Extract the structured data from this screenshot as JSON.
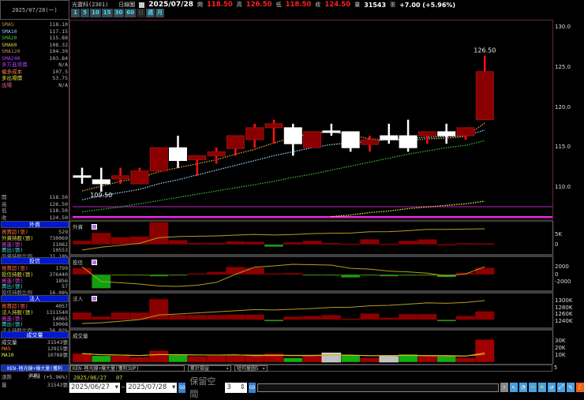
{
  "left": {
    "date": "2025/07/28(一)",
    "sma": [
      {
        "label": "SMA5",
        "value": "118.10",
        "color": "#d08a40"
      },
      {
        "label": "SMA10",
        "value": "117.15",
        "color": "#80c8ff"
      },
      {
        "label": "SMA20",
        "value": "115.88",
        "color": "#40c040"
      },
      {
        "label": "SMA60",
        "value": "108.32",
        "color": "#d0d040"
      },
      {
        "label": "SMA120",
        "value": "104.39",
        "color": "#c08a60"
      },
      {
        "label": "SMA240",
        "value": "103.84",
        "color": "#c040ff"
      }
    ],
    "signals": [
      {
        "label": "多方進場價",
        "value": "N/A",
        "color": "#a040ff"
      },
      {
        "label": "偏多成本",
        "value": "107.5",
        "color": "#ff8040"
      },
      {
        "label": "多出場價",
        "value": "53.75",
        "color": "#e0e040"
      },
      {
        "label": "出場",
        "value": "N/A",
        "color": "#ff60a0"
      }
    ],
    "ohlc": [
      {
        "label": "開",
        "value": "118.50"
      },
      {
        "label": "高",
        "value": "126.50"
      },
      {
        "label": "低",
        "value": "118.50"
      },
      {
        "label": "收",
        "value": "124.50"
      }
    ],
    "sections": [
      {
        "title": "外資",
        "rows": [
          {
            "label": "買賣超(張)",
            "value": "529",
            "color": "#ff6040"
          },
          {
            "label": "外資持股(張)",
            "value": "730069",
            "color": "#e0e040"
          },
          {
            "label": "買進(張)",
            "value": "11082",
            "color": "#e040e0"
          },
          {
            "label": "賣出(張)",
            "value": "10553",
            "color": "#40e0e0"
          },
          {
            "label": "外資持股比例",
            "value": "31.18%",
            "color": "#999"
          }
        ]
      },
      {
        "title": "投信",
        "rows": [
          {
            "label": "買賣超(張)",
            "value": "1799",
            "color": "#ff6040"
          },
          {
            "label": "投信持股(張)",
            "value": "376440",
            "color": "#e0e040"
          },
          {
            "label": "買進(張)",
            "value": "1856",
            "color": "#e040e0"
          },
          {
            "label": "賣出(張)",
            "value": "57",
            "color": "#40e0e0"
          },
          {
            "label": "投信持股比例",
            "value": "16.08%",
            "color": "#999"
          }
        ]
      },
      {
        "title": "法人",
        "rows": [
          {
            "label": "買賣超(張)",
            "value": "4057",
            "color": "#ff6040"
          },
          {
            "label": "法人持股(張)",
            "value": "1311540",
            "color": "#e0e040"
          },
          {
            "label": "買進(張)",
            "value": "14065",
            "color": "#e040e0"
          },
          {
            "label": "賣出(張)",
            "value": "10008",
            "color": "#40e0e0"
          },
          {
            "label": "法人持股比例",
            "value": "56.02%",
            "color": "#999"
          }
        ]
      },
      {
        "title": "成交量",
        "rows": [
          {
            "label": "成交量",
            "value": "31543張",
            "color": "#ccc"
          },
          {
            "label": "MA5",
            "value": "12915張",
            "color": "#ff8040"
          },
          {
            "label": "MA10",
            "value": "10788張",
            "color": "#e0e040"
          }
        ]
      }
    ],
    "strategy_bar": "KEN-極光線+爆大量(獲利3UP)",
    "change_label": "漲跌",
    "change_value": "7.00 (+5.96%)",
    "volume_label": "量",
    "volume_value": "31543張"
  },
  "header": {
    "stock": "光寶科(2301)",
    "chart_type": "日線圖",
    "date": "2025/07/28",
    "open_label": "開",
    "open": "118.50",
    "high_label": "高",
    "high": "126.50",
    "low_label": "低",
    "low": "118.50",
    "close_label": "收",
    "close": "124.50",
    "volume_label": "量",
    "volume": "31543",
    "volume_unit": "張",
    "change": "+7.00 (+5.96%)",
    "periods": [
      "1",
      "5",
      "10",
      "15",
      "30",
      "60",
      "日",
      "週",
      "月"
    ]
  },
  "chart_data": {
    "type": "candlestick",
    "dates": [
      "2025/06/27",
      "07"
    ],
    "price_axis": {
      "ticks": [
        "130.0",
        "125.0",
        "120.0",
        "115.0",
        "110.0"
      ],
      "range": [
        106.2,
        130.8
      ]
    },
    "annotations": {
      "high": "126.50",
      "low": "109.50"
    },
    "candles": [
      [
        111.5,
        112.5,
        110.5,
        111.5
      ],
      [
        111.0,
        112.5,
        109.5,
        110.5
      ],
      [
        111.1,
        112.5,
        110.5,
        111.5
      ],
      [
        110.5,
        112.5,
        110.5,
        112.1
      ],
      [
        112.1,
        115.0,
        112.1,
        115.0
      ],
      [
        115.0,
        116.5,
        112.5,
        113.4
      ],
      [
        113.5,
        114.0,
        111.5,
        114.0
      ],
      [
        114.0,
        115.0,
        113.0,
        114.5
      ],
      [
        114.9,
        116.5,
        114.0,
        116.5
      ],
      [
        116.0,
        118.0,
        115.0,
        117.5
      ],
      [
        117.5,
        118.5,
        115.5,
        118.0
      ],
      [
        117.5,
        118.0,
        114.0,
        115.5
      ],
      [
        115.0,
        117.0,
        115.0,
        117.0
      ],
      [
        117.1,
        118.0,
        116.5,
        117.0
      ],
      [
        117.0,
        117.0,
        114.5,
        115.0
      ],
      [
        115.4,
        116.5,
        114.5,
        116.0
      ],
      [
        116.5,
        118.0,
        115.5,
        116.0
      ],
      [
        116.5,
        118.5,
        114.5,
        115.0
      ],
      [
        116.5,
        117.0,
        115.5,
        117.0
      ],
      [
        117.0,
        118.0,
        115.5,
        116.5
      ],
      [
        116.5,
        117.5,
        116.0,
        117.5
      ],
      [
        118.5,
        126.5,
        118.5,
        124.5
      ]
    ],
    "ma_series": [
      {
        "name": "SMA5",
        "color": "#f0a030",
        "values": [
          109.6,
          110.2,
          110.8,
          111.2,
          112,
          112.5,
          113,
          113.5,
          114.2,
          114.8,
          115.6,
          116.3,
          116.8,
          117,
          116.6,
          116.1,
          116,
          115.9,
          116.1,
          116.2,
          116.4,
          118.1
        ]
      },
      {
        "name": "SMA10",
        "color": "#90d0ff",
        "values": [
          108.5,
          109,
          109.4,
          109.8,
          110.5,
          111,
          111.6,
          112.2,
          112.8,
          113.4,
          114,
          114.5,
          115,
          115.4,
          115.6,
          115.8,
          116,
          116.2,
          116.3,
          116.4,
          116.5,
          117.2
        ]
      },
      {
        "name": "SMA20",
        "color": "#30c030",
        "values": [
          107,
          107.3,
          107.6,
          108,
          108.4,
          108.8,
          109.2,
          109.6,
          110,
          110.4,
          110.8,
          111.3,
          111.7,
          112.2,
          112.7,
          113.2,
          113.7,
          114.2,
          114.6,
          115,
          115.3,
          115.9
        ]
      },
      {
        "name": "SMA60",
        "color": "#f0f040",
        "values": [
          null,
          null,
          null,
          null,
          null,
          null,
          null,
          null,
          null,
          null,
          null,
          null,
          null,
          106.4,
          106.6,
          106.9,
          107.1,
          107.4,
          107.6,
          107.8,
          108.0,
          108.32
        ]
      }
    ],
    "panels": [
      {
        "name": "外資",
        "ticks": [
          {
            "v": 5000,
            "t": "5K"
          },
          {
            "v": 0,
            "t": "0"
          }
        ],
        "range": [
          -4000,
          10500
        ],
        "values": [
          1800,
          5700,
          3600,
          3900,
          11000,
          2100,
          700,
          700,
          1500,
          1300,
          -1200,
          1000,
          1800,
          700,
          300,
          2500,
          300,
          1800,
          2500,
          100,
          600,
          529
        ],
        "holding_end": 730069
      },
      {
        "name": "投信",
        "ticks": [
          {
            "v": 2000,
            "t": "2000"
          },
          {
            "v": 0,
            "t": "0"
          },
          {
            "v": -2000,
            "t": "-2000"
          }
        ],
        "range": [
          -3800,
          4200
        ],
        "values": [
          1700,
          -3700,
          -300,
          -300,
          -500,
          -100,
          300,
          700,
          2000,
          1800,
          300,
          400,
          -100,
          -100,
          -800,
          -200,
          -500,
          -200,
          -300,
          -700,
          500,
          1799
        ],
        "holding_end": 376440
      },
      {
        "name": "法人",
        "ticks": [
          {
            "v": 1300,
            "t": "1300K"
          },
          {
            "v": 1280,
            "t": "1280K"
          },
          {
            "v": 1260,
            "t": "1260K"
          },
          {
            "v": 1240,
            "t": "1240K"
          }
        ],
        "range": [
          -3000,
          12000
        ],
        "values": [
          3500,
          1500,
          3500,
          3500,
          10000,
          2300,
          2300,
          2300,
          2500,
          2500,
          -800,
          1500,
          1800,
          2200,
          500,
          3000,
          1000,
          2700,
          2700,
          -800,
          1800,
          4057
        ],
        "holding_end": 1311540
      },
      {
        "name": "成交量",
        "ticks": [
          {
            "v": 30000,
            "t": "30K"
          },
          {
            "v": 20000,
            "t": "20K"
          },
          {
            "v": 10000,
            "t": "10K"
          }
        ],
        "range": [
          0,
          42000
        ],
        "values": [
          12000,
          9000,
          9000,
          7000,
          16000,
          10000,
          8000,
          9000,
          9000,
          9000,
          12000,
          6000,
          9000,
          13000,
          10000,
          6000,
          8000,
          11000,
          9000,
          8000,
          6000,
          31543
        ],
        "colors": [
          "r",
          "g",
          "r",
          "r",
          "r",
          "g",
          "r",
          "r",
          "r",
          "r",
          "r",
          "g",
          "r",
          "w",
          "g",
          "r",
          "w",
          "g",
          "r",
          "g",
          "r",
          "r"
        ]
      }
    ]
  },
  "controls": {
    "dropdowns": [
      "KEN-極光線+爆大量(獲利3UP)",
      "累計損益",
      "短均量圖5"
    ],
    "start_date": "2025/06/27",
    "end_date": "2025/07/28",
    "go": "GO",
    "reserve_label": "保留空間",
    "reserve_value": "3",
    "right_tick": "5"
  }
}
